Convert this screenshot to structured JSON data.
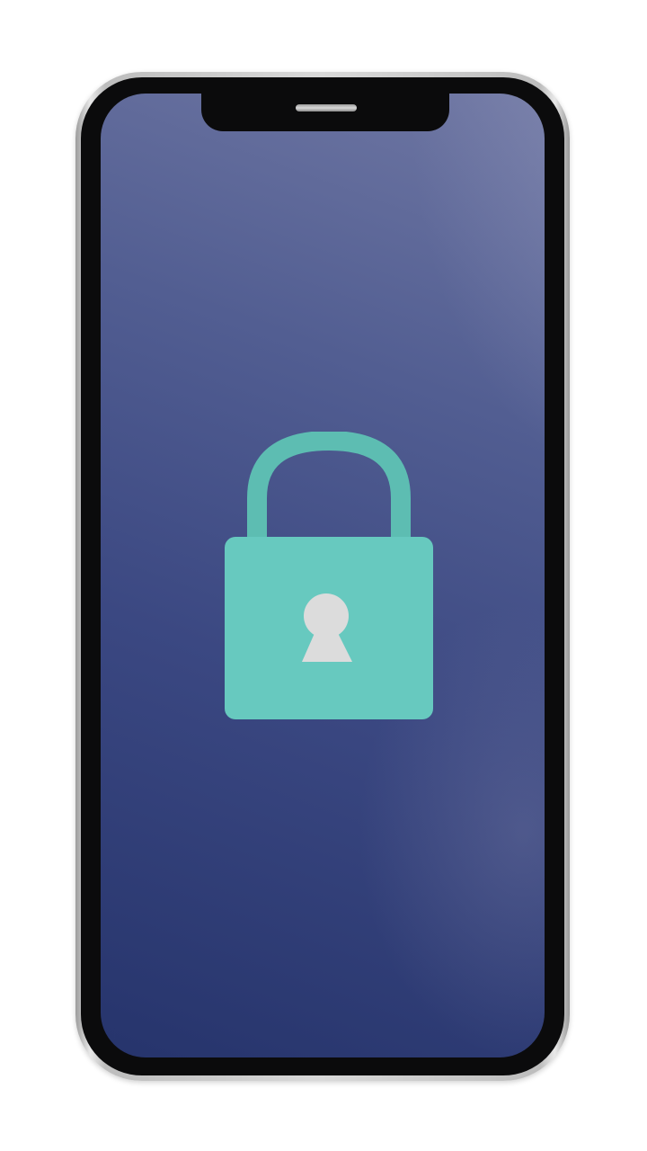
{
  "device": {
    "type": "smartphone",
    "state": "locked"
  },
  "screen": {
    "icon": "padlock-icon",
    "keyhole_icon": "keyhole-icon"
  },
  "colors": {
    "lock_body": "#67c9bf",
    "lock_shackle": "#5dbdb2",
    "keyhole": "#dcdcdc",
    "screen_top": "#6f77a3",
    "screen_bottom": "#26346c",
    "bezel": "#0b0b0c"
  }
}
